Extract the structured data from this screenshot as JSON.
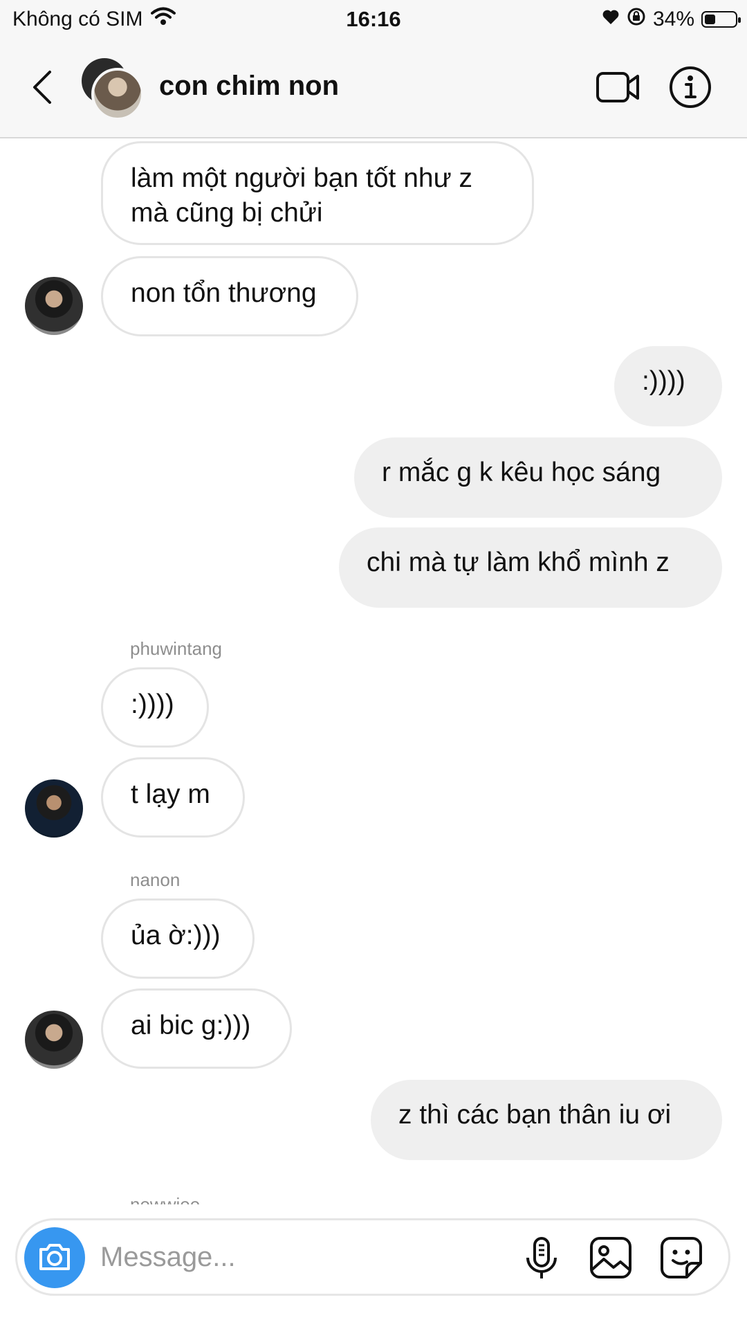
{
  "status_bar": {
    "carrier": "Không có SIM",
    "time": "16:16",
    "battery_percent": "34%",
    "battery_level": 0.34
  },
  "header": {
    "title": "con chim non"
  },
  "messages": [
    {
      "text": "làm một người bạn tốt như z\nmà cũng bị chửi"
    },
    {
      "text": "non tổn thương"
    },
    {
      "text": ":))))"
    },
    {
      "text": "r mắc g k kêu học sáng"
    },
    {
      "text": "chi mà tự làm khổ mình z"
    },
    {
      "sender": "phuwintang",
      "text": ":))))"
    },
    {
      "text": "t lạy m"
    },
    {
      "sender": "nanon",
      "text": "ủa ờ:)))"
    },
    {
      "text": "ai bic g:)))"
    },
    {
      "text": "z thì các bạn thân iu ơi"
    }
  ],
  "partial_sender": "newwiee",
  "composer": {
    "placeholder": "Message..."
  },
  "colors": {
    "accent": "#3797f0",
    "outgoing_bubble": "#efefef",
    "incoming_border": "#e4e4e4"
  }
}
